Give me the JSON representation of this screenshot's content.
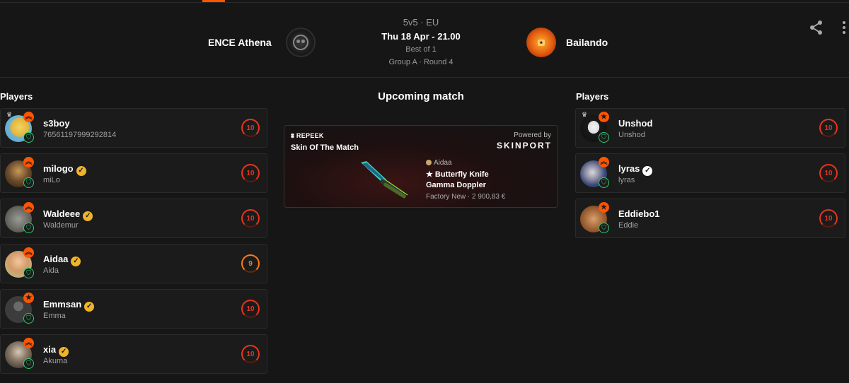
{
  "header": {
    "format": "5v5 · EU",
    "datetime": "Thu 18 Apr - 21.00",
    "best_of": "Best of 1",
    "group_round": "Group A · Round 4",
    "team_a": "ENCE Athena",
    "team_b": "Bailando"
  },
  "left": {
    "title": "Players",
    "players": [
      {
        "name": "s3boy",
        "sub": "76561197999292814",
        "level": "10",
        "verified": false,
        "captain": true,
        "rank_icon": "chevron-up-icon"
      },
      {
        "name": "milogo",
        "sub": "miLo",
        "level": "10",
        "verified": true,
        "captain": false,
        "rank_icon": "chevron-up-icon"
      },
      {
        "name": "Waldeee",
        "sub": "Waldemur",
        "level": "10",
        "verified": true,
        "captain": false,
        "rank_icon": "chevron-up-icon"
      },
      {
        "name": "Aidaa",
        "sub": "Aida",
        "level": "9",
        "verified": true,
        "captain": false,
        "rank_icon": "chevron-up-icon"
      },
      {
        "name": "Emmsan",
        "sub": "Emma",
        "level": "10",
        "verified": true,
        "captain": false,
        "rank_icon": "star-icon"
      },
      {
        "name": "xia",
        "sub": "Akuma",
        "level": "10",
        "verified": true,
        "captain": false,
        "rank_icon": "chevron-up-icon"
      }
    ]
  },
  "right": {
    "title": "Players",
    "players": [
      {
        "name": "Unshod",
        "sub": "Unshod",
        "level": "10",
        "verified": false,
        "captain": true,
        "rank_icon": "star-icon"
      },
      {
        "name": "lyras",
        "sub": "lyras",
        "level": "10",
        "verified": true,
        "captain": false,
        "rank_icon": "chevron-up-icon"
      },
      {
        "name": "Eddiebo1",
        "sub": "Eddie",
        "level": "10",
        "verified": false,
        "captain": false,
        "rank_icon": "star-icon"
      }
    ]
  },
  "upcoming": {
    "title": "Upcoming match",
    "brand": "REPEEK",
    "skin_title": "Skin Of The Match",
    "powered_by": "Powered by",
    "sponsor": "SKINPORT",
    "owner": "Aidaa",
    "item_line1": "★ Butterfly Knife",
    "item_line2": "Gamma Doppler",
    "meta": "Factory New · 2 900,83 €"
  },
  "colors": {
    "accent": "#ff5500",
    "level_red": "#e8341c",
    "level_orange": "#ff7a1a",
    "verified_gold": "#f0b429",
    "shield_green": "#2ecc71"
  }
}
